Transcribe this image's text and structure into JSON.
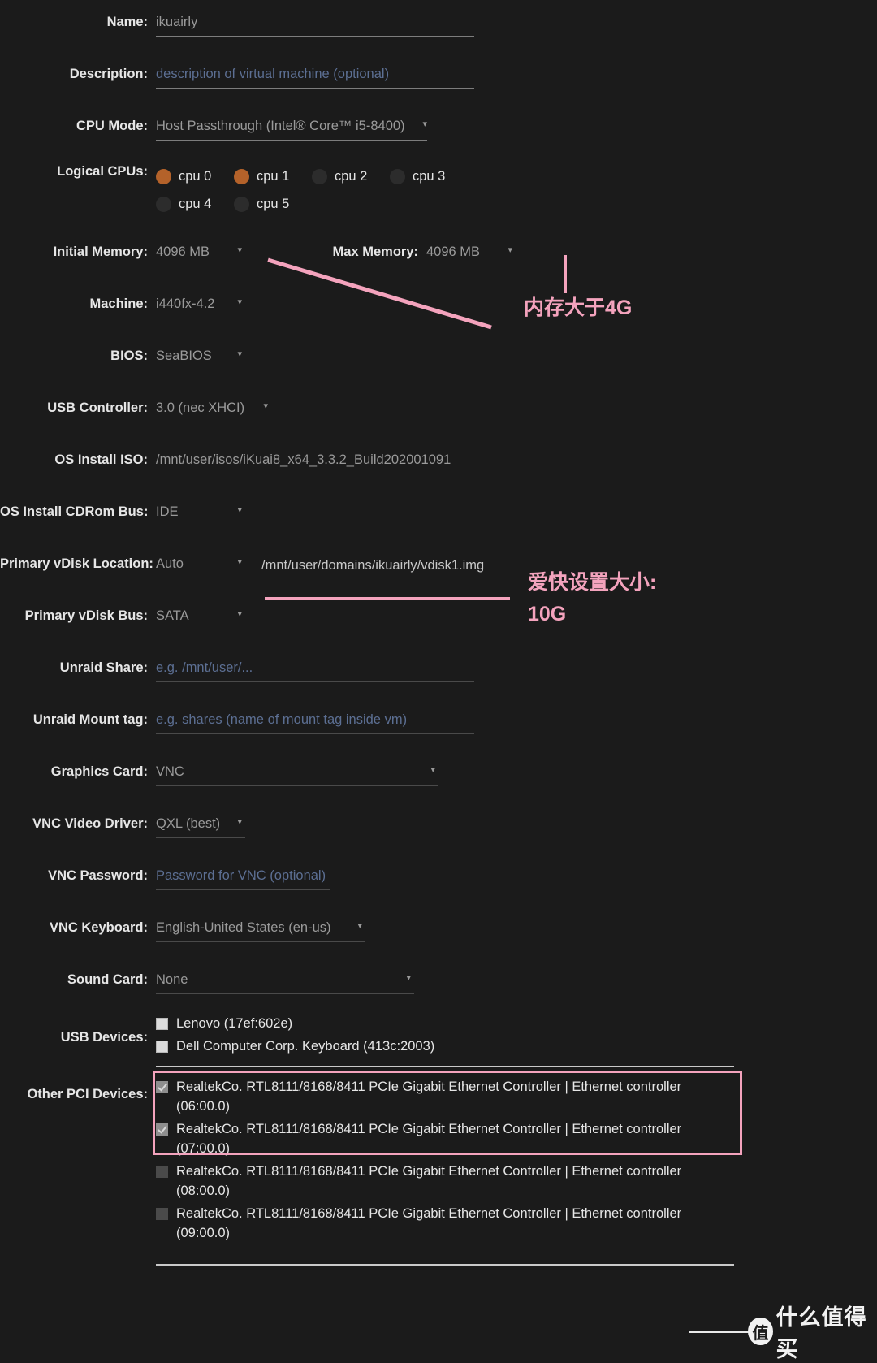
{
  "fields": {
    "name": {
      "label": "Name:",
      "value": "ikuairly"
    },
    "description": {
      "label": "Description:",
      "placeholder": "description of virtual machine (optional)"
    },
    "cpu_mode": {
      "label": "CPU Mode:",
      "value": "Host Passthrough (Intel® Core™ i5-8400)"
    },
    "logical_cpus": {
      "label": "Logical CPUs:"
    },
    "initial_memory": {
      "label": "Initial Memory:",
      "value": "4096 MB"
    },
    "max_memory": {
      "label": "Max Memory:",
      "value": "4096 MB"
    },
    "machine": {
      "label": "Machine:",
      "value": "i440fx-4.2"
    },
    "bios": {
      "label": "BIOS:",
      "value": "SeaBIOS"
    },
    "usb_controller": {
      "label": "USB Controller:",
      "value": "3.0 (nec XHCI)"
    },
    "os_install_iso": {
      "label": "OS Install ISO:",
      "value": "/mnt/user/isos/iKuai8_x64_3.3.2_Build202001091"
    },
    "os_install_cdrom_bus": {
      "label": "OS Install CDRom Bus:",
      "value": "IDE"
    },
    "primary_vdisk_location": {
      "label": "Primary vDisk Location:",
      "value": "Auto",
      "path": "/mnt/user/domains/ikuairly/vdisk1.img"
    },
    "primary_vdisk_bus": {
      "label": "Primary vDisk Bus:",
      "value": "SATA"
    },
    "unraid_share": {
      "label": "Unraid Share:",
      "placeholder": "e.g. /mnt/user/..."
    },
    "unraid_mount_tag": {
      "label": "Unraid Mount tag:",
      "placeholder": "e.g. shares (name of mount tag inside vm)"
    },
    "graphics_card": {
      "label": "Graphics Card:",
      "value": "VNC"
    },
    "vnc_video_driver": {
      "label": "VNC Video Driver:",
      "value": "QXL (best)"
    },
    "vnc_password": {
      "label": "VNC Password:",
      "placeholder": "Password for VNC (optional)"
    },
    "vnc_keyboard": {
      "label": "VNC Keyboard:",
      "value": "English-United States (en-us)"
    },
    "sound_card": {
      "label": "Sound Card:",
      "value": "None"
    },
    "usb_devices": {
      "label": "USB Devices:"
    },
    "other_pci_devices": {
      "label": "Other PCI Devices:"
    }
  },
  "cpus": [
    {
      "name": "cpu 0",
      "selected": true
    },
    {
      "name": "cpu 1",
      "selected": true
    },
    {
      "name": "cpu 2",
      "selected": false
    },
    {
      "name": "cpu 3",
      "selected": false
    },
    {
      "name": "cpu 4",
      "selected": false
    },
    {
      "name": "cpu 5",
      "selected": false
    }
  ],
  "usb_devices": [
    {
      "label": "Lenovo (17ef:602e)",
      "checked": false
    },
    {
      "label": "Dell Computer Corp. Keyboard (413c:2003)",
      "checked": false
    }
  ],
  "pci_devices": [
    {
      "label": "RealtekCo. RTL8111/8168/8411 PCIe Gigabit Ethernet Controller | Ethernet controller (06:00.0)",
      "checked": true
    },
    {
      "label": "RealtekCo. RTL8111/8168/8411 PCIe Gigabit Ethernet Controller | Ethernet controller (07:00.0)",
      "checked": true
    },
    {
      "label": "RealtekCo. RTL8111/8168/8411 PCIe Gigabit Ethernet Controller | Ethernet controller (08:00.0)",
      "checked": false
    },
    {
      "label": "RealtekCo. RTL8111/8168/8411 PCIe Gigabit Ethernet Controller | Ethernet controller (09:00.0)",
      "checked": false
    }
  ],
  "annotations": {
    "memory_note": "内存大于4G",
    "vdisk_note_line1": "爱快设置大小:",
    "vdisk_note_line2": "10G"
  },
  "watermark": {
    "badge": "值",
    "text": "什么值得买"
  },
  "colors": {
    "background": "#1b1b1b",
    "accent_pink": "#f4a3bd",
    "cpu_selected": "#b4622a",
    "placeholder_blue": "#5c6f93",
    "label_text": "#e6e6e6",
    "value_text": "#9a9a9a"
  },
  "icons": {
    "caret": "▾"
  }
}
